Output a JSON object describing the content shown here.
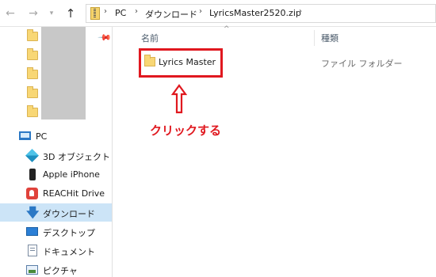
{
  "window": {
    "breadcrumb": [
      "PC",
      "ダウンロード",
      "LyricsMaster2520.zip"
    ]
  },
  "nav": {
    "pc": "PC",
    "items": [
      {
        "label": "3D オブジェクト",
        "icon": "cube-icon"
      },
      {
        "label": "Apple iPhone",
        "icon": "phone-icon"
      },
      {
        "label": "REACHit Drive",
        "icon": "reachit-drive-icon"
      },
      {
        "label": "ダウンロード",
        "icon": "download-icon",
        "selected": true
      },
      {
        "label": "デスクトップ",
        "icon": "desktop-icon"
      },
      {
        "label": "ドキュメント",
        "icon": "document-icon"
      },
      {
        "label": "ピクチャ",
        "icon": "picture-icon"
      }
    ]
  },
  "content": {
    "columns": {
      "name": "名前",
      "type": "種類"
    },
    "files": [
      {
        "name": "Lyrics Master",
        "type": "ファイル フォルダー"
      }
    ],
    "annotation": "クリックする"
  },
  "colors": {
    "highlight": "#e0181f",
    "selected_bg": "#cce4f7",
    "folder": "#f8d775"
  }
}
